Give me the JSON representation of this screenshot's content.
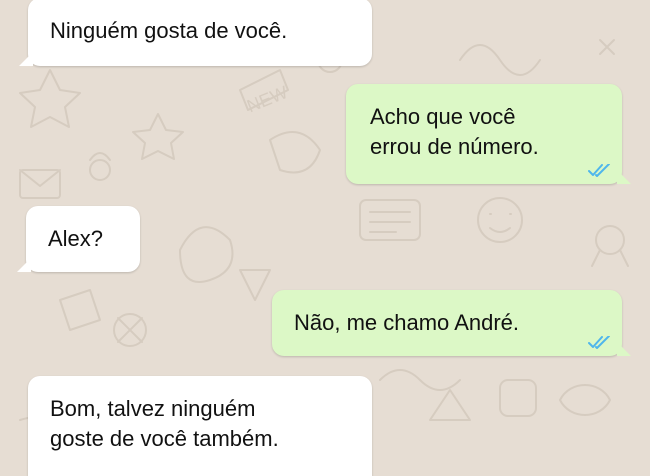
{
  "chat": {
    "wallpaper_color": "#e6ddd3",
    "incoming_color": "#ffffff",
    "outgoing_color": "#dcf8c6",
    "read_tick_color": "#4fb6ec",
    "messages": [
      {
        "direction": "incoming",
        "text": "Ninguém gosta de você."
      },
      {
        "direction": "outgoing",
        "text": "Acho que você\nerrou de número.",
        "status": "read-double-check-icon"
      },
      {
        "direction": "incoming",
        "text": "Alex?"
      },
      {
        "direction": "outgoing",
        "text": "Não, me chamo André.",
        "status": "read-double-check-icon"
      },
      {
        "direction": "incoming",
        "text": "Bom, talvez ninguém\ngoste de você também."
      }
    ]
  }
}
